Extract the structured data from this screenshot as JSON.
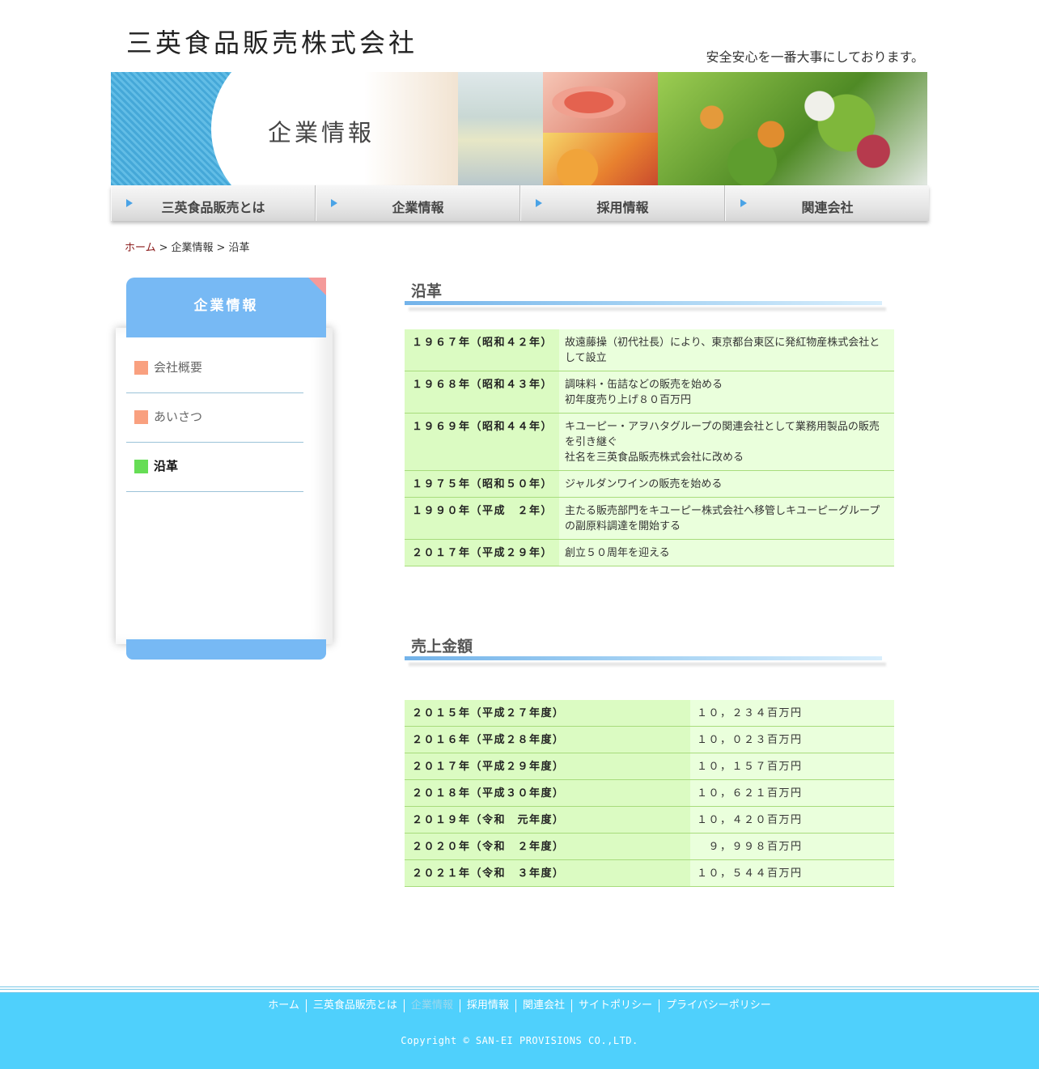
{
  "header": {
    "logo": "三英食品販売株式会社",
    "tagline": "安全安心を一番大事にしております。"
  },
  "banner": {
    "title": "企業情報"
  },
  "gnav": [
    {
      "label": "三英食品販売とは"
    },
    {
      "label": "企業情報"
    },
    {
      "label": "採用情報"
    },
    {
      "label": "関連会社"
    }
  ],
  "breadcrumb": {
    "home": "ホーム",
    "level1": "企業情報",
    "current": "沿革",
    "sep": ">"
  },
  "sidebar": {
    "title": "企業情報",
    "items": [
      {
        "label": "会社概要"
      },
      {
        "label": "あいさつ"
      },
      {
        "label": "沿革"
      }
    ]
  },
  "history": {
    "title": "沿革",
    "rows": [
      {
        "year": "１９６７年（昭和４２年）",
        "lines": [
          "故遠藤操（初代社長）により、東京都台東区に発紅物産株式会社として設立"
        ]
      },
      {
        "year": "１９６８年（昭和４３年）",
        "lines": [
          "調味料・缶詰などの販売を始める",
          "初年度売り上げ８０百万円"
        ]
      },
      {
        "year": "１９６９年（昭和４４年）",
        "lines": [
          "キユーピー・アヲハタグループの関連会社として業務用製品の販売を引き継ぐ",
          "社名を三英食品販売株式会社に改める"
        ]
      },
      {
        "year": "１９７５年（昭和５０年）",
        "lines": [
          "ジャルダンワインの販売を始める"
        ]
      },
      {
        "year": "１９９０年（平成　２年）",
        "lines": [
          "主たる販売部門をキユーピー株式会社へ移管しキユーピーグループの副原料調達を開始する"
        ]
      },
      {
        "year": "２０１７年（平成２９年）",
        "lines": [
          "創立５０周年を迎える"
        ]
      }
    ]
  },
  "sales": {
    "title": "売上金額",
    "rows": [
      {
        "year": "２０１５年（平成２７年度）",
        "amount": "１０，２３４百万円"
      },
      {
        "year": "２０１６年（平成２８年度）",
        "amount": "１０，０２３百万円"
      },
      {
        "year": "２０１７年（平成２９年度）",
        "amount": "１０，１５７百万円"
      },
      {
        "year": "２０１８年（平成３０年度）",
        "amount": "１０，６２１百万円"
      },
      {
        "year": "２０１９年（令和　元年度）",
        "amount": "１０，４２０百万円"
      },
      {
        "year": "２０２０年（令和　２年度）",
        "amount": "　９，９９８百万円"
      },
      {
        "year": "２０２１年（令和　３年度）",
        "amount": "１０，５４４百万円"
      }
    ]
  },
  "footer": {
    "nav": [
      {
        "label": "ホーム"
      },
      {
        "label": "三英食品販売とは"
      },
      {
        "label": "企業情報"
      },
      {
        "label": "採用情報"
      },
      {
        "label": "関連会社"
      },
      {
        "label": "サイトポリシー"
      },
      {
        "label": "プライバシーポリシー"
      }
    ],
    "copyright": "Copyright © SAN-EI PROVISIONS CO.,LTD."
  },
  "colors": {
    "nav_accent": "#4aa3e6",
    "side_header": "#77b9f4",
    "table_head": "#dbfbc2",
    "table_cell": "#eaffdc",
    "footer_bg": "#4fd0fc",
    "marker_inactive": "#f9a07f",
    "marker_active": "#66dd55"
  }
}
